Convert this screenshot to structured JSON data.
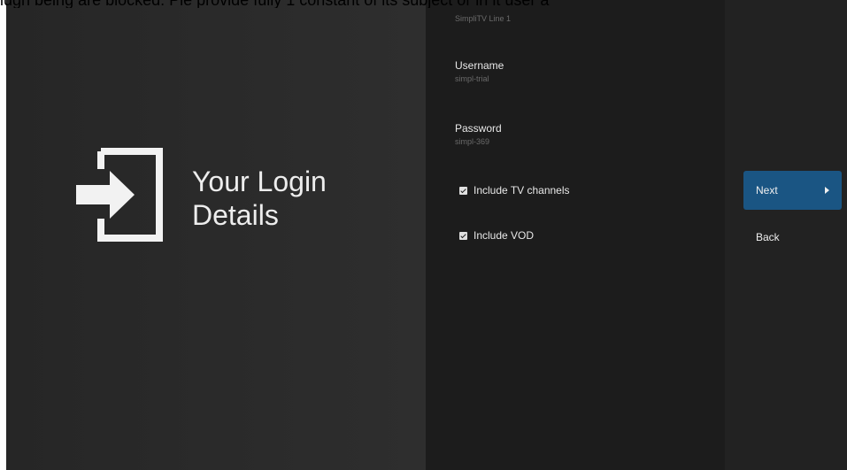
{
  "overlay": {
    "text": "iugh being are blocked. Ple provide fully 1 constant of its subject or in it user a"
  },
  "guidance": {
    "title_line1": "Your Login",
    "title_line2": "Details",
    "icon": "login-icon"
  },
  "form": {
    "top_value": "SimpliTV Line 1",
    "username_label": "Username",
    "username_value": "simpl-trial",
    "password_label": "Password",
    "password_value": "simpl-369",
    "options": [
      {
        "label": "Include TV channels",
        "checked": true
      },
      {
        "label": "Include VOD",
        "checked": true
      }
    ]
  },
  "actions": {
    "next_label": "Next",
    "next_icon": "chevron-right-icon",
    "back_label": "Back"
  },
  "colors": {
    "accent": "#1a5583",
    "left_pane": "#2c2c2c",
    "form_pane": "#1c1c1c",
    "action_pane": "#222222"
  }
}
